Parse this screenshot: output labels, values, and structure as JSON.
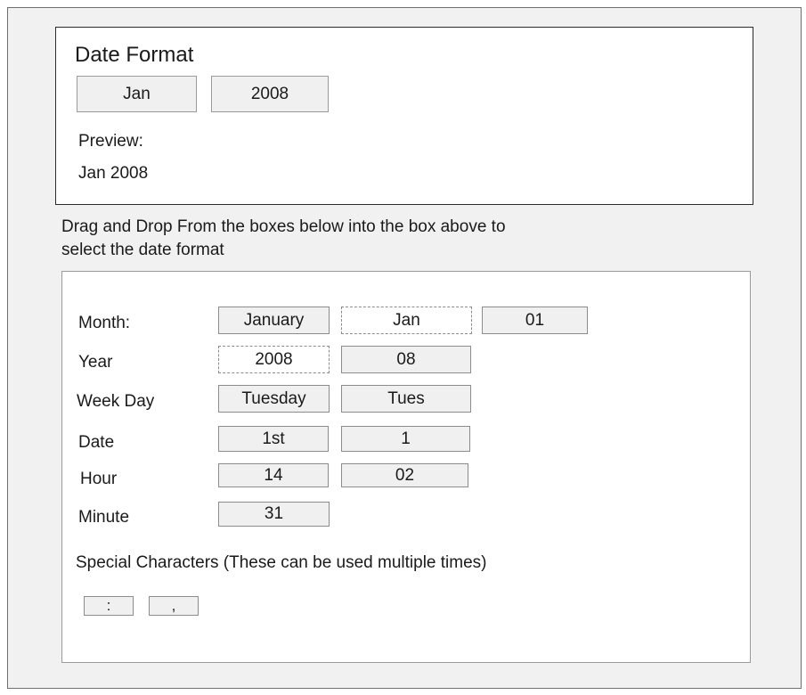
{
  "format_box": {
    "title": "Date Format",
    "selected": [
      "Jan",
      "2008"
    ],
    "preview_label": "Preview:",
    "preview_value": "Jan 2008"
  },
  "instructions": {
    "line1": "Drag and Drop From the boxes below into the box above to",
    "line2": "select the date format"
  },
  "options": {
    "month": {
      "label": "Month:",
      "chips": [
        "January",
        "Jan",
        "01"
      ]
    },
    "year": {
      "label": "Year",
      "chips": [
        "2008",
        "08"
      ]
    },
    "weekday": {
      "label": "Week Day",
      "chips": [
        "Tuesday",
        "Tues"
      ]
    },
    "date": {
      "label": "Date",
      "chips": [
        "1st",
        "1"
      ]
    },
    "hour": {
      "label": "Hour",
      "chips": [
        "14",
        "02"
      ]
    },
    "minute": {
      "label": "Minute",
      "chips": [
        "31"
      ]
    }
  },
  "special": {
    "label": "Special Characters (These can be used multiple times)",
    "chips": [
      ":",
      ","
    ]
  }
}
